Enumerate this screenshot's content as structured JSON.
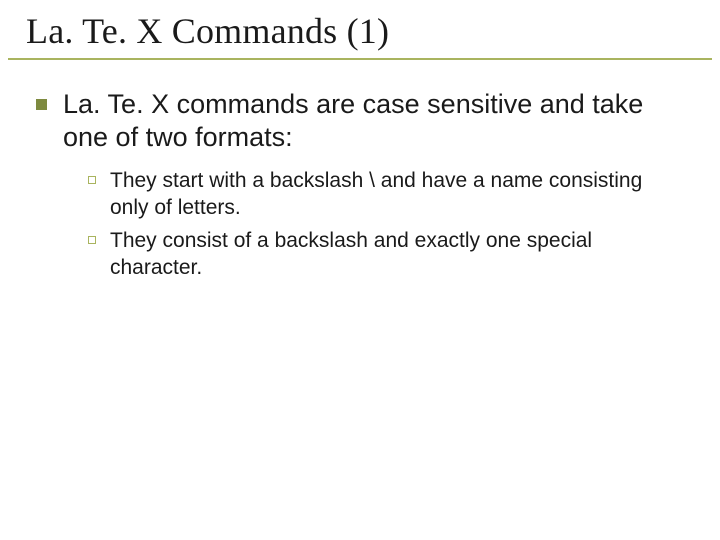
{
  "slide": {
    "title": "La. Te. X Commands (1)",
    "bullets": [
      {
        "text": "La. Te. X commands are case sensitive and take one of two formats:",
        "sub": [
          {
            "text": "They start with a backslash \\ and have a name consisting only of letters."
          },
          {
            "text": "They consist of a backslash and exactly one special character."
          }
        ]
      }
    ]
  },
  "colors": {
    "accent": "#a9b45f",
    "bullet_fill": "#7e8a3f"
  }
}
